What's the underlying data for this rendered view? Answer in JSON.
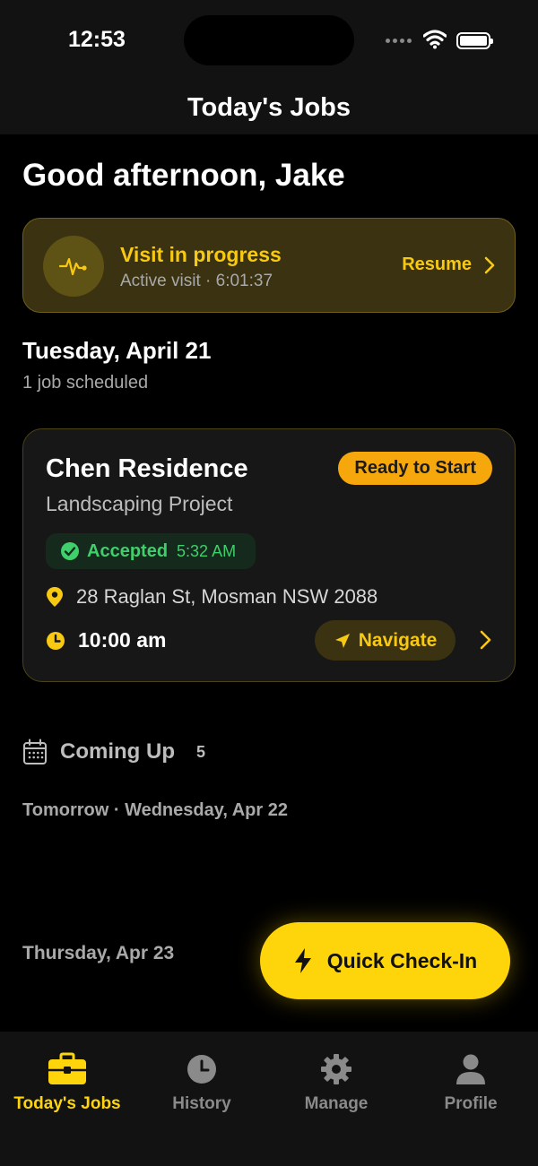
{
  "status_bar": {
    "time": "12:53"
  },
  "nav": {
    "title": "Today's Jobs"
  },
  "greeting": "Good afternoon, Jake",
  "visit": {
    "title": "Visit in progress",
    "subtitle": "Active visit · 6:01:37",
    "action_label": "Resume",
    "icon": "activity-icon"
  },
  "schedule": {
    "date": "Tuesday, April 21",
    "summary": "1 job scheduled"
  },
  "job": {
    "title": "Chen Residence",
    "status": "Ready to Start",
    "subtitle": "Landscaping Project",
    "accepted_label": "Accepted",
    "accepted_time": "5:32 AM",
    "address": "28 Raglan St, Mosman NSW 2088",
    "time": "10:00 am",
    "navigate_label": "Navigate"
  },
  "coming_up": {
    "title": "Coming Up",
    "count": "5",
    "days": [
      "Tomorrow · Wednesday, Apr 22",
      "Thursday, Apr 23"
    ]
  },
  "quick_checkin": {
    "label": "Quick Check-In"
  },
  "tabs": [
    {
      "label": "Today's Jobs",
      "icon": "briefcase-icon",
      "active": true
    },
    {
      "label": "History",
      "icon": "clock-icon",
      "active": false
    },
    {
      "label": "Manage",
      "icon": "gear-icon",
      "active": false
    },
    {
      "label": "Profile",
      "icon": "person-icon",
      "active": false
    }
  ],
  "colors": {
    "accent": "#fed50a",
    "badge": "#f5a70c",
    "success": "#3fcf6b",
    "background": "#000000",
    "surface": "#121212"
  }
}
